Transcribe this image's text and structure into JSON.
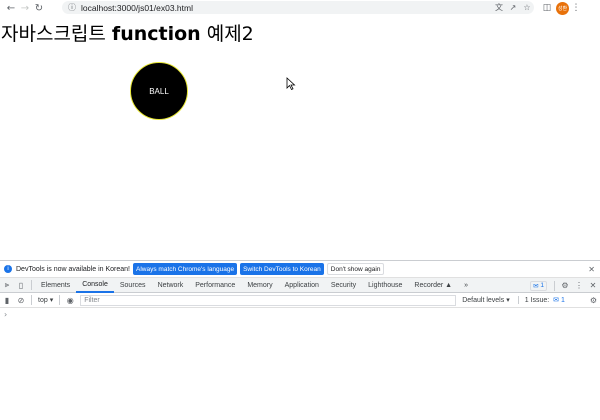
{
  "browser": {
    "url": "localhost:3000/js01/ex03.html",
    "profile_initials": "성환",
    "icons": [
      "back-icon",
      "forward-icon",
      "reload-icon",
      "info-icon",
      "translate-icon",
      "share-icon",
      "star-icon",
      "sidepanel-icon"
    ]
  },
  "page": {
    "title_korean_1": "자바스크립트 ",
    "title_fn": "function",
    "title_korean_2": " 예제2",
    "ball_label": "BALL"
  },
  "devtools": {
    "infobar": {
      "message": "DevTools is now available in Korean!",
      "btn_match": "Always match Chrome's language",
      "btn_switch": "Switch DevTools to Korean",
      "btn_dont_show": "Don't show again"
    },
    "tabs": [
      "Elements",
      "Console",
      "Sources",
      "Network",
      "Performance",
      "Memory",
      "Application",
      "Security",
      "Lighthouse",
      "Recorder"
    ],
    "active_tab": "Console",
    "more_tabs": "»",
    "message_count": "1",
    "filter": {
      "context": "top",
      "placeholder": "Filter",
      "levels": "Default levels",
      "issues_label": "1 Issue:",
      "issues_count": "1"
    },
    "prompt": "›"
  },
  "colors": {
    "accent": "#1a73e8",
    "ball": "#000000",
    "ball_border": "#e6e632",
    "avatar": "#e8710a"
  }
}
